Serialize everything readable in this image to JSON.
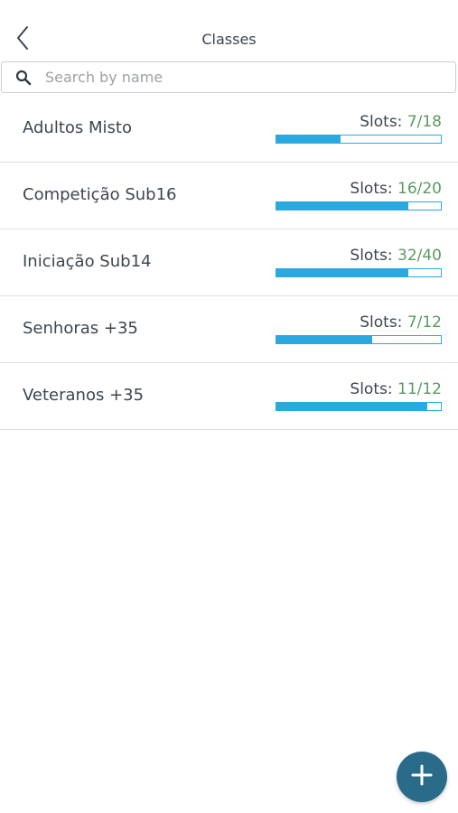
{
  "header": {
    "title": "Classes",
    "back_icon": "chevron-left-icon"
  },
  "search": {
    "placeholder": "Search by name",
    "value": "",
    "icon": "search-icon"
  },
  "colors": {
    "accent": "#2aa9e0",
    "slots_value": "#5a9a62",
    "fab": "#2a6b8a"
  },
  "classes": [
    {
      "name": "Adultos Misto",
      "slots_label": "Slots:",
      "slots_value": "7/18",
      "filled": 7,
      "total": 18
    },
    {
      "name": "Competição Sub16",
      "slots_label": "Slots:",
      "slots_value": "16/20",
      "filled": 16,
      "total": 20
    },
    {
      "name": "Iniciação Sub14",
      "slots_label": "Slots:",
      "slots_value": "32/40",
      "filled": 32,
      "total": 40
    },
    {
      "name": "Senhoras +35",
      "slots_label": "Slots:",
      "slots_value": "7/12",
      "filled": 7,
      "total": 12
    },
    {
      "name": "Veteranos +35",
      "slots_label": "Slots:",
      "slots_value": "11/12",
      "filled": 11,
      "total": 12
    }
  ],
  "fab": {
    "icon": "plus-icon"
  }
}
